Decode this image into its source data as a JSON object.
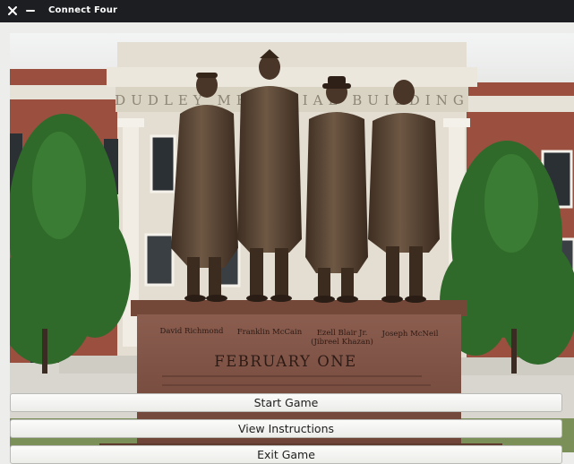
{
  "window": {
    "title": "Connect Four",
    "close_icon": "close-icon",
    "minimize_icon": "minimize-icon"
  },
  "background_image": {
    "description_icon": "photo",
    "plaque": {
      "names": [
        "David Richmond",
        "Franklin McCain",
        "Ezell Blair Jr.",
        "(Jibreel Khazan)",
        "Joseph McNeil"
      ],
      "heading": "FEBRUARY ONE"
    },
    "building_inscription": "DUDLEY MEMORIAL BUILDING"
  },
  "menu": {
    "start_label": "Start Game",
    "instructions_label": "View Instructions",
    "exit_label": "Exit Game"
  }
}
